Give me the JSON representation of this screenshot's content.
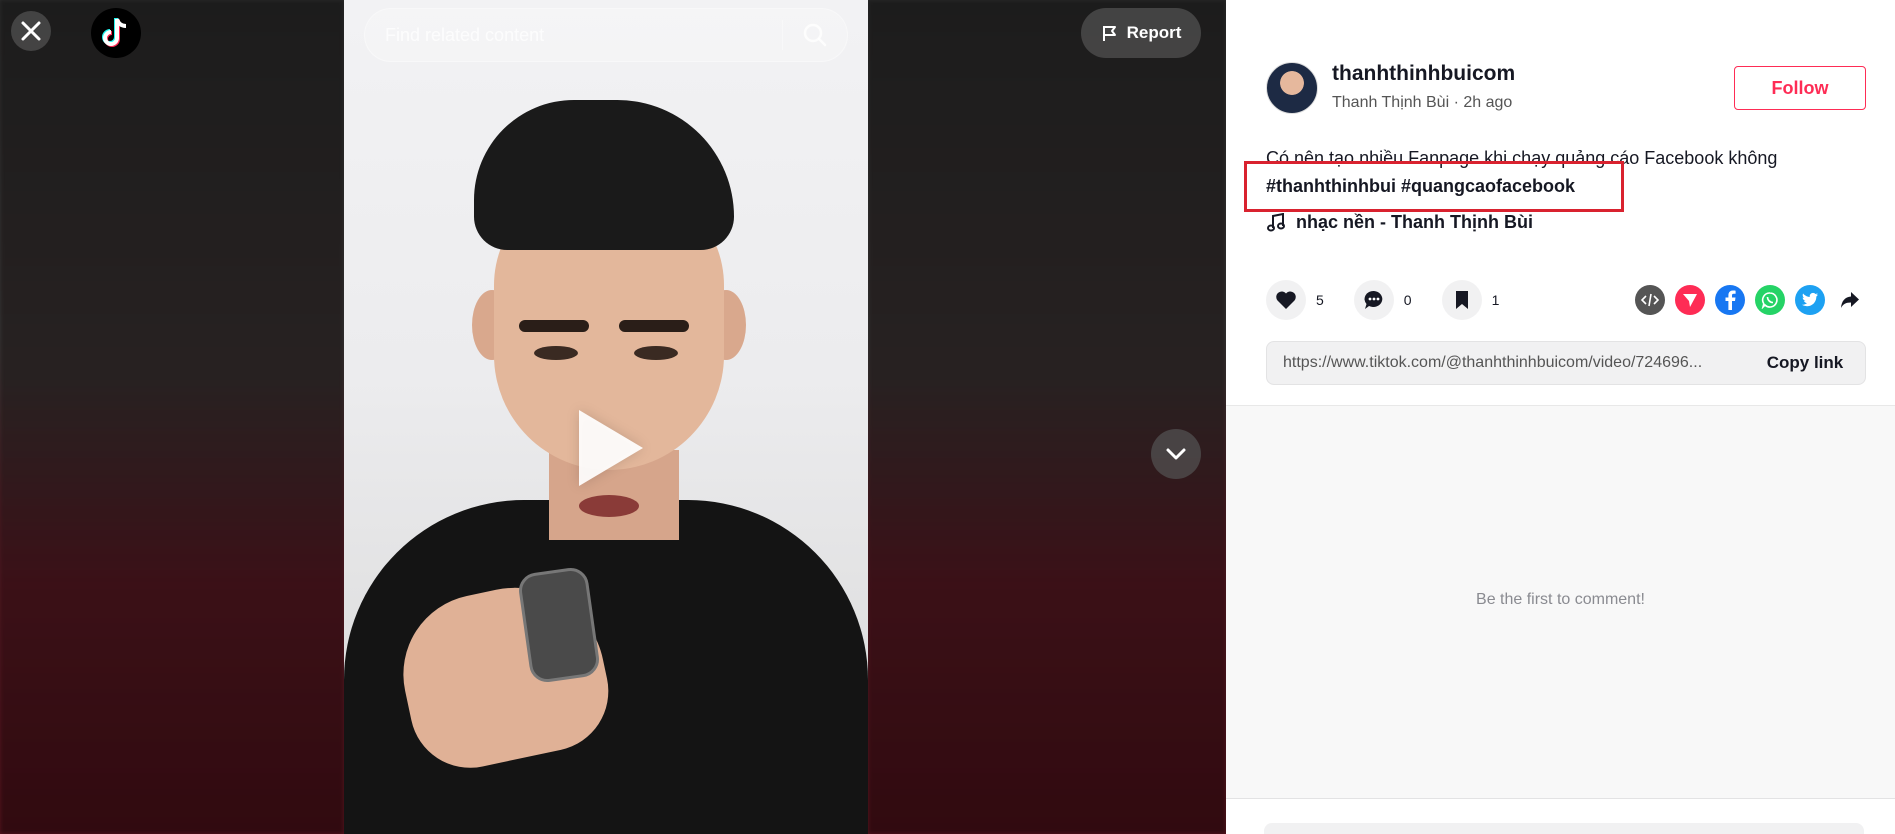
{
  "search": {
    "placeholder": "Find related content"
  },
  "report": {
    "label": "Report"
  },
  "post": {
    "username": "thanhthinhbuicom",
    "display_meta": "Thanh Thịnh Bùi · 2h ago",
    "follow_label": "Follow",
    "caption": "Có nên tạo nhiều Fanpage khi chạy quảng cáo Facebook không",
    "hashtags": "#thanhthinhbui #quangcaofacebook",
    "music": "nhạc nền - Thanh Thịnh Bùi"
  },
  "actions": {
    "likes": "5",
    "comments": "0",
    "saves": "1"
  },
  "share": {
    "icons": [
      "embed-icon",
      "send-icon",
      "facebook-icon",
      "whatsapp-icon",
      "twitter-icon",
      "share-arrow-icon"
    ],
    "colors": {
      "embed": "#555555",
      "send": "#fe2c55",
      "facebook": "#1877f2",
      "whatsapp": "#25d366",
      "twitter": "#1da1f2"
    }
  },
  "link": {
    "url": "https://www.tiktok.com/@thanhthinhbuicom/video/724696...",
    "copy_label": "Copy link"
  },
  "comments": {
    "empty_text": "Be the first to comment!"
  },
  "colors": {
    "accent": "#fe2c55",
    "highlight_box": "#d9222f"
  }
}
